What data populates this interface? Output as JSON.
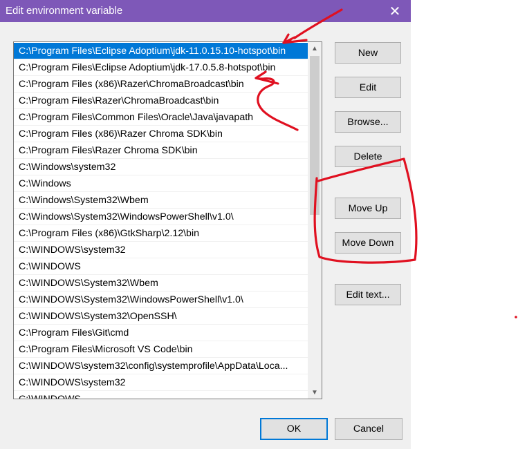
{
  "window": {
    "title": "Edit environment variable",
    "close_glyph": "✕"
  },
  "path_list": {
    "selected_index": 0,
    "items": [
      "C:\\Program Files\\Eclipse Adoptium\\jdk-11.0.15.10-hotspot\\bin",
      "C:\\Program Files\\Eclipse Adoptium\\jdk-17.0.5.8-hotspot\\bin",
      "C:\\Program Files (x86)\\Razer\\ChromaBroadcast\\bin",
      "C:\\Program Files\\Razer\\ChromaBroadcast\\bin",
      "C:\\Program Files\\Common Files\\Oracle\\Java\\javapath",
      "C:\\Program Files (x86)\\Razer Chroma SDK\\bin",
      "C:\\Program Files\\Razer Chroma SDK\\bin",
      "C:\\Windows\\system32",
      "C:\\Windows",
      "C:\\Windows\\System32\\Wbem",
      "C:\\Windows\\System32\\WindowsPowerShell\\v1.0\\",
      "C:\\Program Files (x86)\\GtkSharp\\2.12\\bin",
      "C:\\WINDOWS\\system32",
      "C:\\WINDOWS",
      "C:\\WINDOWS\\System32\\Wbem",
      "C:\\WINDOWS\\System32\\WindowsPowerShell\\v1.0\\",
      "C:\\WINDOWS\\System32\\OpenSSH\\",
      "C:\\Program Files\\Git\\cmd",
      "C:\\Program Files\\Microsoft VS Code\\bin",
      "C:\\WINDOWS\\system32\\config\\systemprofile\\AppData\\Loca...",
      "C:\\WINDOWS\\system32",
      "C:\\WINDOWS"
    ]
  },
  "buttons": {
    "new": "New",
    "edit": "Edit",
    "browse": "Browse...",
    "delete": "Delete",
    "move_up": "Move Up",
    "move_down": "Move Down",
    "edit_text": "Edit text...",
    "ok": "OK",
    "cancel": "Cancel"
  },
  "icons": {
    "scroll_up": "chevron-up-icon",
    "scroll_down": "chevron-down-icon",
    "close": "close-icon"
  },
  "colors": {
    "title_bar": "#7e58b8",
    "selection": "#0078d7",
    "annotation_red": "#e01020"
  }
}
